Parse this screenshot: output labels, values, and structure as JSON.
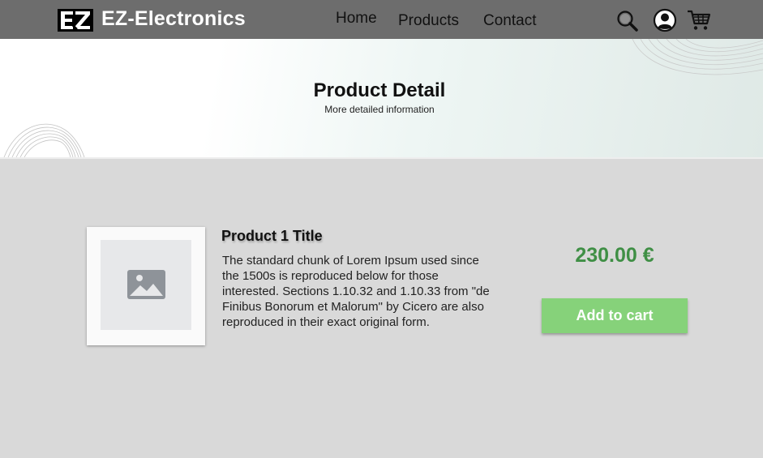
{
  "header": {
    "brand_name": "EZ-Electronics",
    "logo_icon": "ez-logo-icon",
    "nav": {
      "home": "Home",
      "products": "Products",
      "contact": "Contact"
    },
    "icons": [
      "search-icon",
      "account-icon",
      "cart-icon"
    ]
  },
  "banner": {
    "title": "Product Detail",
    "subtitle": "More detailed information"
  },
  "product": {
    "image_icon": "image-placeholder-icon",
    "title": "Product 1 Title",
    "description": "The standard chunk of Lorem Ipsum used since the 1500s is reproduced below for those interested. Sections 1.10.32 and 1.10.33 from \"de Finibus Bonorum et Malorum\" by Cicero are also reproduced in their exact original form.",
    "price": "230.00 €",
    "add_to_cart_label": "Add to cart"
  },
  "colors": {
    "header_bg": "#6d6d6d",
    "page_bg": "#d9d9d9",
    "price": "#3f8f45",
    "button_bg": "#86d27a"
  }
}
